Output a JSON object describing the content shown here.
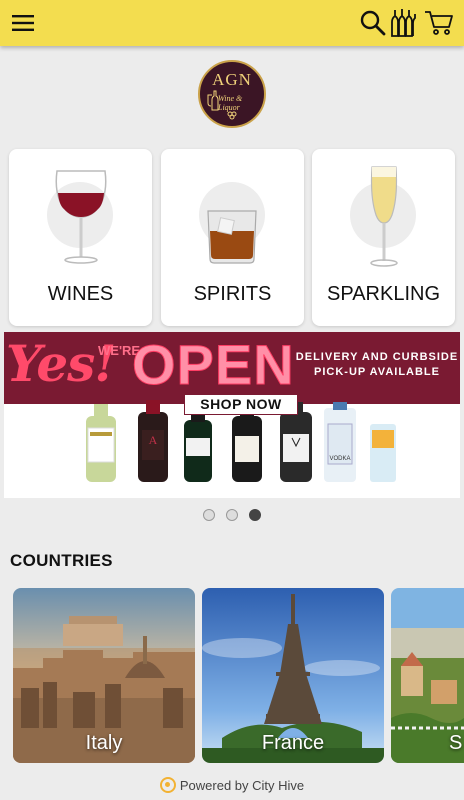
{
  "header": {
    "menu_icon": "hamburger-menu-icon",
    "search_icon": "search-icon",
    "winelist_icon": "bottles-icon",
    "cart_icon": "cart-icon",
    "background": "#f3dd4f"
  },
  "logo": {
    "title": "AGN",
    "subtitle": "Wine & Liquor"
  },
  "categories": [
    {
      "label": "WINES",
      "icon": "red-wine-glass-icon"
    },
    {
      "label": "SPIRITS",
      "icon": "whiskey-glass-icon"
    },
    {
      "label": "SPARKLING",
      "icon": "champagne-flute-icon"
    }
  ],
  "banner": {
    "yes": "Yes!",
    "were": "WE'RE",
    "open": "OPEN",
    "delivery": "DELIVERY AND CURBSIDE PICK-UP AVAILABLE",
    "shop_now": "SHOP NOW",
    "background": "#7a1a32"
  },
  "carousel": {
    "slide_count": 3,
    "active_index": 2
  },
  "countries_section": {
    "title": "COUNTRIES",
    "items": [
      {
        "label": "Italy"
      },
      {
        "label": "France"
      },
      {
        "label": "S"
      }
    ]
  },
  "footer": {
    "text": "Powered by City Hive"
  }
}
